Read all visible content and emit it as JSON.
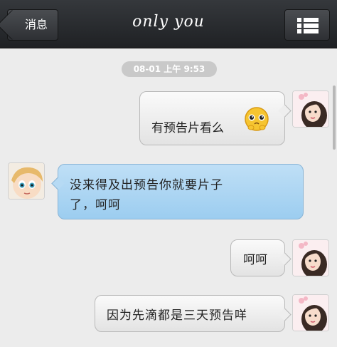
{
  "nav": {
    "back_label": "消息",
    "title": "only you",
    "menu_icon": "list-menu-icon"
  },
  "timestamp": "08-01 上午 9:53",
  "messages": [
    {
      "side": "right",
      "text": "有预告片看么",
      "emoji": "cute-face-emoji",
      "avatar": "my-avatar"
    },
    {
      "side": "left",
      "line1": "没来得及出预告你就要片子",
      "line2": "了，呵呵",
      "avatar": "friend-avatar"
    },
    {
      "side": "right",
      "text": "呵呵",
      "avatar": "my-avatar"
    },
    {
      "side": "right",
      "text": "因为先滴都是三天预告咩",
      "avatar": "my-avatar"
    }
  ],
  "colors": {
    "nav_bg": "#2a2c30",
    "page_bg": "#ececec",
    "incoming_bubble": "#a9d3f2",
    "outgoing_bubble": "#efefef"
  }
}
